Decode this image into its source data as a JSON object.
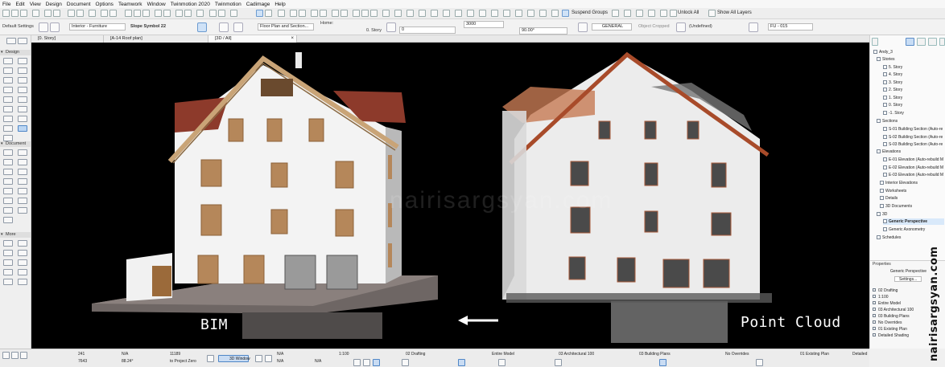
{
  "menu": {
    "items": [
      "File",
      "Edit",
      "View",
      "Design",
      "Document",
      "Options",
      "Teamwork",
      "Window",
      "Twinmotion 2020",
      "Twinmotion",
      "Cadimage",
      "Help"
    ]
  },
  "toolbar": {
    "suspend_groups": "Suspend Groups",
    "unlock_all": "Unlock All",
    "show_all_layers": "Show All Layers"
  },
  "infobox": {
    "default_settings": "Default Settings",
    "layer": "Interior - Furniture",
    "symbol": "Slope Symbol 22",
    "view_map": "Floor Plan and Section...",
    "home_label": "Home:",
    "story": "0. Story",
    "elevation_value": "0",
    "size_value": "3000",
    "angle_value": "90.00°",
    "shading": "GENERAL",
    "object_state": "Object Cropped",
    "renovation": "(Undefined)",
    "id_value": "FU - 015"
  },
  "toolbox": {
    "design_label": "Design",
    "document_label": "Document",
    "more_label": "More"
  },
  "tabs": [
    {
      "label": "[0. Story]"
    },
    {
      "label": "[A-14 Roof plan]"
    },
    {
      "label": "[3D / All]",
      "active": true
    }
  ],
  "viewport": {
    "bim_label": "BIM",
    "point_cloud_label": "Point Cloud",
    "watermark": "nairisargsyan.com",
    "colors": {
      "background": "#000000",
      "wall": "#f4f4f4",
      "roof": "#8e3a2a",
      "trim": "#c9a877",
      "base": "#6b6462"
    }
  },
  "navigator": {
    "root": "Andy_3",
    "stories_label": "Stories",
    "stories": [
      "5. Story",
      "4. Story",
      "3. Story",
      "2. Story",
      "1. Story",
      "0. Story",
      "-1. Story"
    ],
    "sections_label": "Sections",
    "sections": [
      "S-01 Building Section (Auto-re",
      "S-02 Building Section (Auto-re",
      "S-03 Building Section (Auto-re"
    ],
    "elevations_label": "Elevations",
    "elevations": [
      "E-01 Elevation (Auto-rebuild M",
      "E-02 Elevation (Auto-rebuild M",
      "E-03 Elevation (Auto-rebuild M"
    ],
    "others": [
      "Interior Elevations",
      "Worksheets",
      "Details",
      "3D Documents"
    ],
    "threed_label": "3D",
    "threed_items": [
      "Generic Perspective",
      "Generic Axonometry"
    ],
    "schedules_label": "Schedules"
  },
  "properties": {
    "header": "Properties",
    "name": "Generic Perspective",
    "settings_button": "Settings...",
    "rows": [
      "02 Drafting",
      "1:100",
      "Entire Model",
      "03 Architectural 100",
      "03 Building Plans",
      "No Overrides",
      "01 Existing Plan",
      "Detailed Shading"
    ]
  },
  "statusbar": {
    "dx": "241",
    "dy": "7643",
    "angle": "88.24°",
    "dr": "11189",
    "to_project_zero": "to Project Zero",
    "window_3d": "3D Window",
    "scale": "1:100",
    "drafting": "02 Drafting",
    "model": "Entire Model",
    "pen_set": "03 Architectural 100",
    "plans": "03 Building Plans",
    "overrides": "No Overrides",
    "existing": "01 Existing Plan",
    "shading": "Detailed Shading",
    "na1": "N/A",
    "na2": "N/A",
    "na3": "N/A",
    "na4": "N/A"
  },
  "side_signature": "nairisargsyan.com"
}
